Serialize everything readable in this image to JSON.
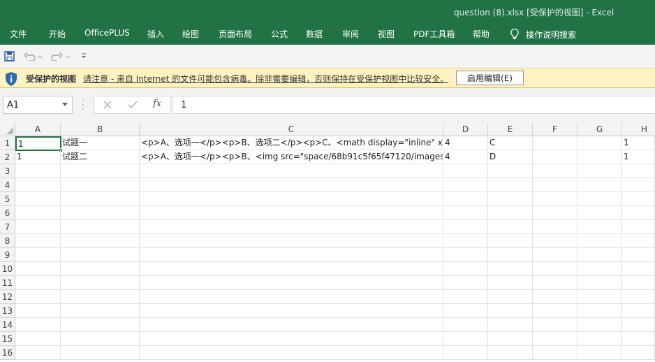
{
  "window": {
    "title": "question (8).xlsx  [受保护的视图]  -  Excel"
  },
  "ribbon": {
    "tabs": [
      "文件",
      "开始",
      "OfficePLUS",
      "插入",
      "绘图",
      "页面布局",
      "公式",
      "数据",
      "审阅",
      "视图",
      "PDF工具箱",
      "帮助"
    ],
    "search_label": "操作说明搜索"
  },
  "protected_view": {
    "title": "受保护的视图",
    "message": "请注意 - 来自 Internet 的文件可能包含病毒。除非需要编辑，否则保持在受保护视图中比较安全。",
    "button": "启用编辑(E)"
  },
  "formula_bar": {
    "name_box": "A1",
    "formula": "1",
    "fx_label": "fx"
  },
  "sheet": {
    "columns": [
      "A",
      "B",
      "C",
      "D",
      "E",
      "F",
      "G",
      "H"
    ],
    "rows": [
      "1",
      "2",
      "3",
      "4",
      "5",
      "6",
      "7",
      "8",
      "9",
      "10",
      "11",
      "12",
      "13",
      "14",
      "15",
      "16"
    ],
    "cells": [
      [
        "1",
        "试题一",
        "<p>A、选项一</p><p>B、选项二</p><p>C、<math display=\"inline\" x",
        "4",
        "C",
        "",
        "",
        "1"
      ],
      [
        "1",
        "试题二",
        "<p>A、选项一</p><p>B、<img src=\"space/68b91c5f65f47120/images/",
        "4",
        "D",
        "",
        "",
        "1"
      ]
    ],
    "selected_cell": "A1"
  },
  "colors": {
    "accent": "#217346",
    "protected_bar": "#fff3c4",
    "shield": "#2b6cb0"
  }
}
